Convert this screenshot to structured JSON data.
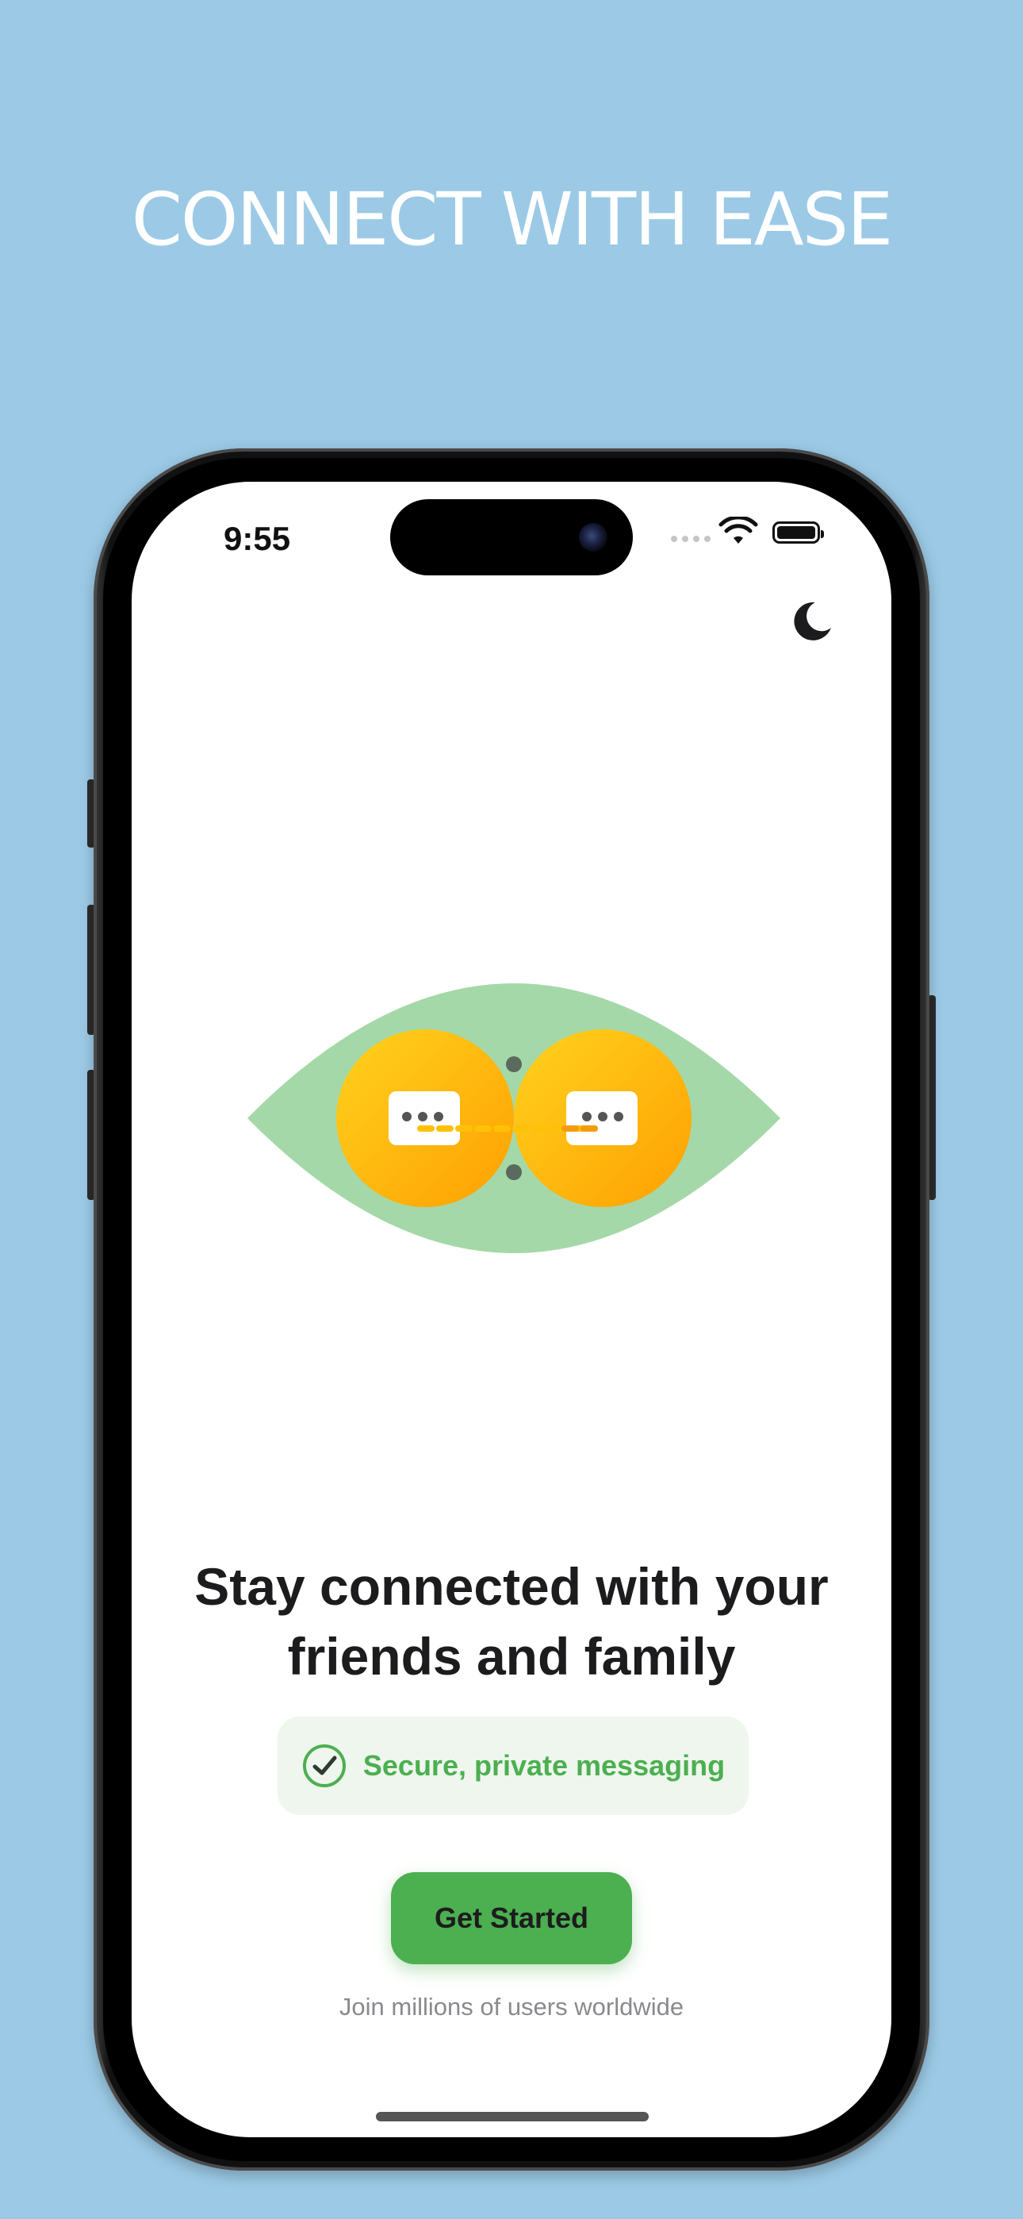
{
  "banner": {
    "headline": "CONNECT WITH EASE"
  },
  "status_bar": {
    "time": "9:55",
    "battery_level": 1.0
  },
  "theme_toggle": {
    "icon": "moon-icon"
  },
  "illustration": {
    "icon": "linked-chat-bubbles-illustration"
  },
  "hero": {
    "title_line1": "Stay connected with your",
    "title_line2": "friends and family"
  },
  "badge": {
    "icon": "check-circle-icon",
    "text": "Secure, private messaging"
  },
  "cta": {
    "label": "Get Started"
  },
  "footnote": {
    "text": "Join millions of users worldwide"
  },
  "colors": {
    "background": "#9ccae6",
    "accent": "#4caf50",
    "leaf": "#a5d8a8",
    "bubble": "#ffc107",
    "badge_bg": "#eef6ee"
  }
}
